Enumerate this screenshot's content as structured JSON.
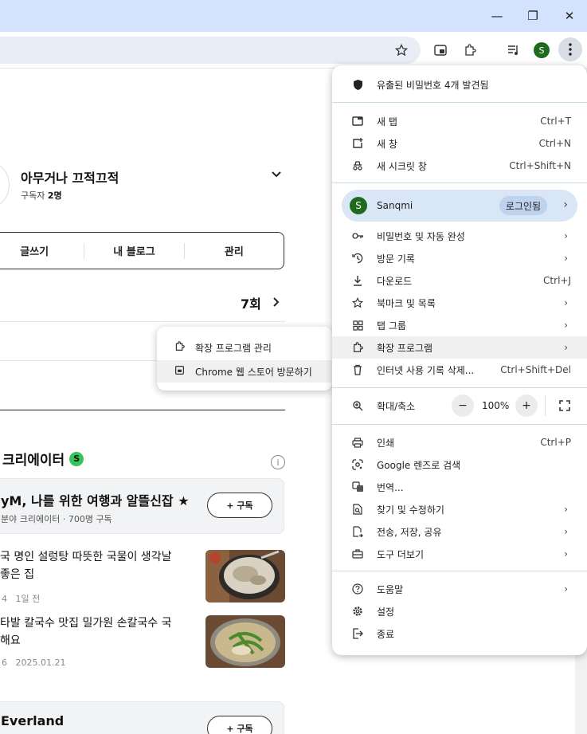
{
  "window": {
    "minimize": "—",
    "maximize": "❐",
    "close": "✕"
  },
  "toolbar": {
    "bookmark_icon": "star-icon",
    "profile_initial": "S"
  },
  "blog": {
    "name": "아무거나 끄적끄적",
    "subscribers_label": "구독자",
    "subscribers_count": "2명",
    "buttons": [
      "글쓰기",
      "내 블로그",
      "관리"
    ],
    "post_count": "7회"
  },
  "creators": {
    "title": "크리에이터",
    "badge": "S",
    "card1_title": "yM, 나를 위한 여행과 알뜰신잡 ★",
    "card1_sub": "분야 크리에이터 · 700명 구독",
    "subscribe_label": "+ 구독",
    "posts": [
      {
        "line1": "국 명인 설렁탕 따뜻한 국물이 생각날",
        "line2": "좋은 집",
        "meta_a": "4",
        "meta_b": "1일 전"
      },
      {
        "line1": "타발 칼국수 맛집 밀가원 손칼국수 국",
        "line2": "해요",
        "meta_a": "6",
        "meta_b": "2025.01.21"
      }
    ],
    "card2_title": "Everland"
  },
  "menu": {
    "breach": "유출된 비밀번호 4개 발견됨",
    "new_tab": "새 탭",
    "new_tab_sc": "Ctrl+T",
    "new_window": "새 창",
    "new_window_sc": "Ctrl+N",
    "incognito": "새 시크릿 창",
    "incognito_sc": "Ctrl+Shift+N",
    "profile_name": "Sanqmi",
    "profile_initial": "S",
    "login": "로그인됨",
    "passwords": "비밀번호 및 자동 완성",
    "history": "방문 기록",
    "downloads": "다운로드",
    "downloads_sc": "Ctrl+J",
    "bookmarks": "북마크 및 목록",
    "tab_groups": "탭 그룹",
    "extensions": "확장 프로그램",
    "clear_data": "인터넷 사용 기록 삭제...",
    "clear_data_sc": "Ctrl+Shift+Del",
    "zoom": "확대/축소",
    "zoom_minus": "−",
    "zoom_value": "100%",
    "zoom_plus": "+",
    "print": "인쇄",
    "print_sc": "Ctrl+P",
    "lens": "Google 렌즈로 검색",
    "translate": "번역...",
    "find": "찾기 및 수정하기",
    "cast": "전송, 저장, 공유",
    "more_tools": "도구 더보기",
    "help": "도움말",
    "settings": "설정",
    "exit": "종료",
    "arrow": "›"
  },
  "submenu": {
    "manage": "확장 프로그램 관리",
    "webstore": "Chrome 웹 스토어 방문하기"
  }
}
